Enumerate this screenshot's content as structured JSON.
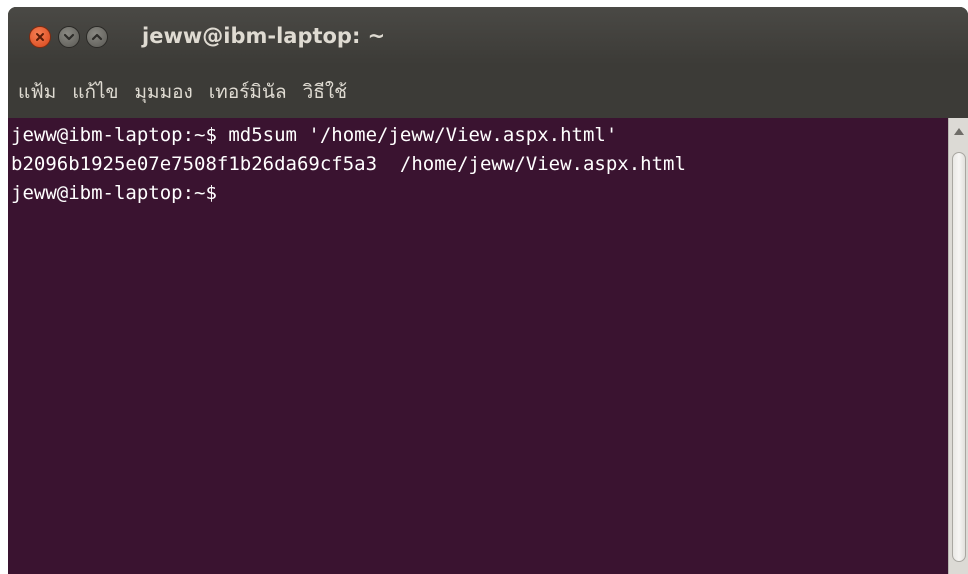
{
  "window": {
    "title": "jeww@ibm-laptop: ~"
  },
  "menubar": {
    "items": [
      {
        "label": "แฟ้ม"
      },
      {
        "label": "แก้ไข"
      },
      {
        "label": "มุมมอง"
      },
      {
        "label": "เทอร์มินัล"
      },
      {
        "label": "วิธีใช้"
      }
    ]
  },
  "terminal": {
    "lines": [
      "jeww@ibm-laptop:~$ md5sum '/home/jeww/View.aspx.html'",
      "b2096b1925e07e7508f1b26da69cf5a3  /home/jeww/View.aspx.html",
      "jeww@ibm-laptop:~$ "
    ]
  },
  "colors": {
    "terminal_bg": "#3a1330",
    "titlebar_bg": "#3c3b37",
    "text": "#dfdbd2",
    "close_button": "#e05a26"
  },
  "icons": {
    "close": "close-icon",
    "minimize": "minimize-icon",
    "maximize": "maximize-icon",
    "scroll_up": "arrow-up-icon"
  }
}
